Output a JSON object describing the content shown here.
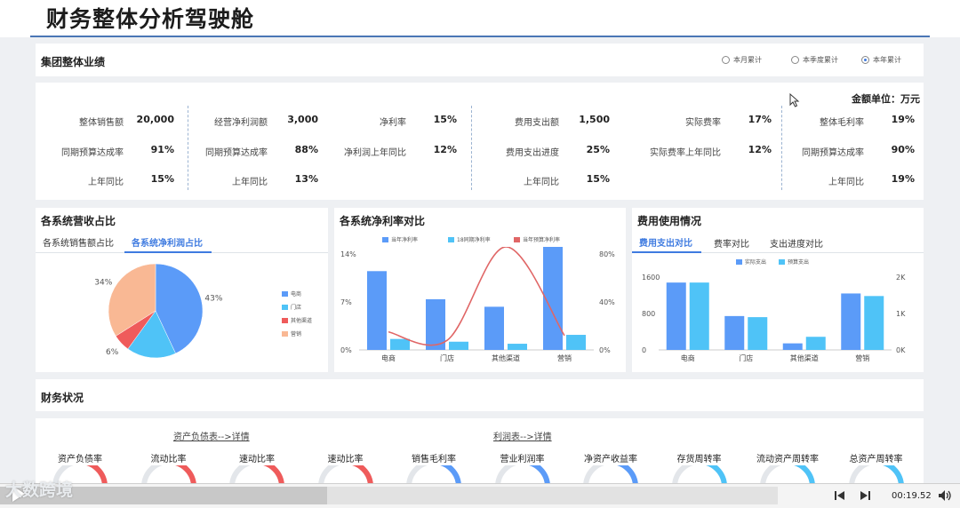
{
  "page": {
    "title": "财务整体分析驾驶舱"
  },
  "performance": {
    "title": "集团整体业绩",
    "radios": [
      {
        "label": "本月累计",
        "selected": false
      },
      {
        "label": "本季度累计",
        "selected": false
      },
      {
        "label": "本年累计",
        "selected": true
      }
    ],
    "unit": "金额单位：万元",
    "kpis": [
      {
        "label": "整体销售额",
        "value": "20,000"
      },
      {
        "label": "同期预算达成率",
        "value": "91%"
      },
      {
        "label": "上年同比",
        "value": "15%"
      },
      {
        "label": "经营净利润额",
        "value": "3,000"
      },
      {
        "label": "同期预算达成率",
        "value": "88%"
      },
      {
        "label": "上年同比",
        "value": "13%"
      },
      {
        "label": "净利率",
        "value": "15%"
      },
      {
        "label": "净利润上年同比",
        "value": "12%"
      },
      {
        "label": "费用支出额",
        "value": "1,500"
      },
      {
        "label": "费用支出进度",
        "value": "25%"
      },
      {
        "label": "上年同比",
        "value": "15%"
      },
      {
        "label": "实际费率",
        "value": "17%"
      },
      {
        "label": "实际费率上年同比",
        "value": "12%"
      },
      {
        "label": "整体毛利率",
        "value": "19%"
      },
      {
        "label": "同期预算达成率",
        "value": "90%"
      },
      {
        "label": "上年同比",
        "value": "19%"
      }
    ]
  },
  "revenue_share": {
    "title": "各系统营收占比",
    "tabs": [
      "各系统销售额占比",
      "各系统净利润占比"
    ],
    "active_tab": 1
  },
  "net_margin": {
    "title": "各系统净利率对比"
  },
  "expense": {
    "title": "费用使用情况",
    "tabs": [
      "费用支出对比",
      "费率对比",
      "支出进度对比"
    ],
    "active_tab": 0
  },
  "chart_data": [
    {
      "type": "pie",
      "categories": [
        "电商",
        "门店",
        "其他渠道",
        "营销"
      ],
      "values": [
        43,
        17,
        6,
        34
      ],
      "labels": [
        "43%",
        "",
        "6%",
        "34%"
      ],
      "colors": [
        "#5b9bf8",
        "#4fc3f7",
        "#ef5b5b",
        "#f9b894"
      ],
      "legend": "right"
    },
    {
      "type": "bar",
      "categories": [
        "电商",
        "门店",
        "其他渠道",
        "营销"
      ],
      "series": [
        {
          "name": "当年净利率",
          "values": [
            11.5,
            7.4,
            6.3,
            15.5
          ],
          "color": "#5b9bf8"
        },
        {
          "name": "18同期净利率",
          "values": [
            1.6,
            1.2,
            0.9,
            2.2
          ],
          "color": "#4fc3f7"
        },
        {
          "name": "当年预算净利率",
          "values": [
            15,
            8,
            86,
            12
          ],
          "color": "#e06666",
          "type": "line",
          "axis": "right"
        }
      ],
      "y_left_ticks": [
        "14%",
        "7%",
        "0%"
      ],
      "y_right_ticks": [
        "80%",
        "40%",
        "0%"
      ],
      "ylim": [
        0,
        14
      ],
      "y2lim": [
        0,
        80
      ],
      "legend": "top"
    },
    {
      "type": "bar",
      "categories": [
        "电商",
        "门店",
        "其他渠道",
        "营销"
      ],
      "series": [
        {
          "name": "实际支出",
          "values": [
            1850,
            930,
            180,
            1550
          ],
          "color": "#5b9bf8"
        },
        {
          "name": "预算支出",
          "values": [
            1850,
            900,
            360,
            1480
          ],
          "color": "#4fc3f7"
        }
      ],
      "y_left_ticks": [
        "1600",
        "800",
        "0"
      ],
      "y_right_ticks": [
        "2K",
        "1K",
        "0K"
      ],
      "ylim": [
        0,
        2000
      ],
      "legend": "top"
    }
  ],
  "finance": {
    "title": "财务状况",
    "link_balance": "资产负债表-->详情",
    "link_income": "利润表-->详情",
    "gauges": [
      {
        "label": "资产负债率",
        "color": "#ef5b5b"
      },
      {
        "label": "流动比率",
        "color": "#ef5b5b"
      },
      {
        "label": "速动比率",
        "color": "#ef5b5b"
      },
      {
        "label": "速动比率",
        "color": "#ef5b5b"
      },
      {
        "label": "销售毛利率",
        "color": "#5b9bf8"
      },
      {
        "label": "营业利润率",
        "color": "#5b9bf8"
      },
      {
        "label": "净资产收益率",
        "color": "#5b9bf8"
      },
      {
        "label": "存货周转率",
        "color": "#4fc3f7"
      },
      {
        "label": "流动资产周转率",
        "color": "#4fc3f7"
      },
      {
        "label": "总资产周转率",
        "color": "#4fc3f7"
      }
    ]
  },
  "player": {
    "time": "00:19.52",
    "progress": 0.42,
    "watermark": "大数跨境"
  }
}
